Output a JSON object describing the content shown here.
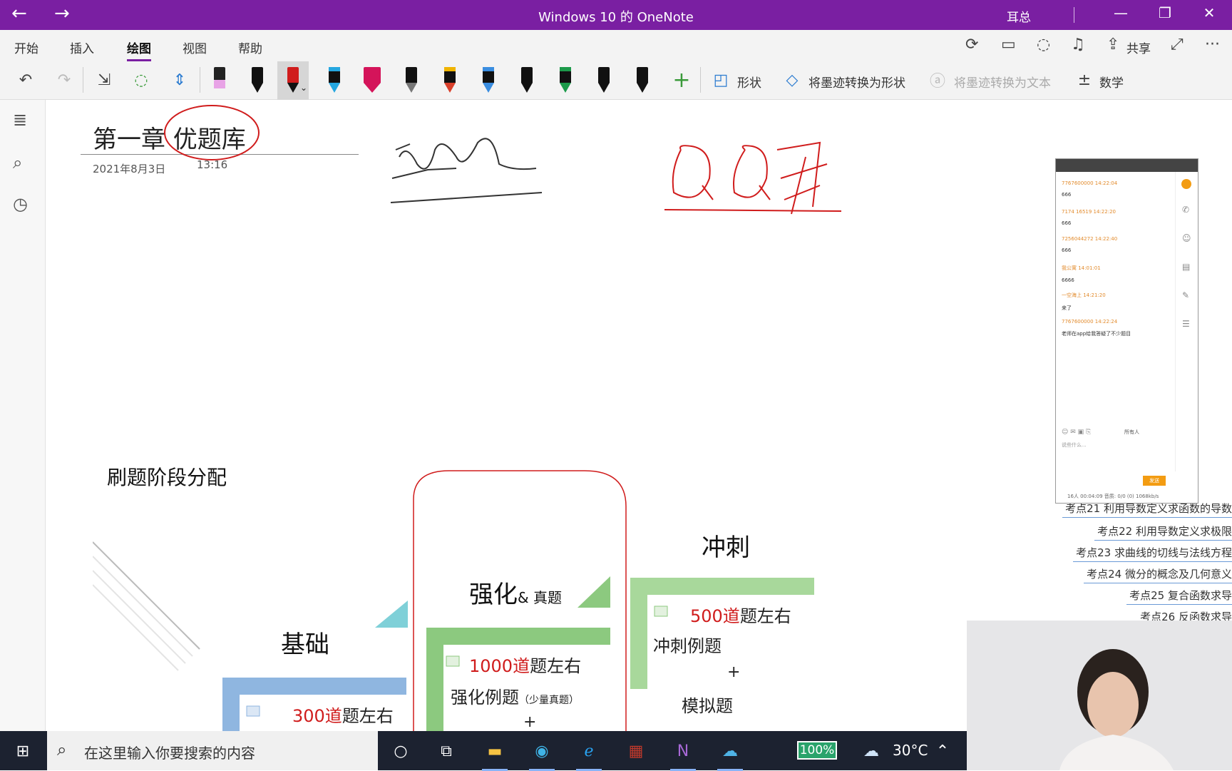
{
  "titlebar": {
    "title": "Windows 10 的 OneNote",
    "user": "耳总",
    "back": "←",
    "forward": "→",
    "min": "—",
    "max": "❐",
    "close": "✕"
  },
  "ribbon": {
    "tabs": [
      "开始",
      "插入",
      "绘图",
      "视图",
      "帮助"
    ],
    "active_tab": "绘图",
    "share_label": "共享",
    "more": "···",
    "shapes_label": "形状",
    "ink_to_shape_label": "将墨迹转换为形状",
    "ink_to_text_label": "将墨迹转换为文本",
    "math_label": "数学",
    "add_pen": "+"
  },
  "page": {
    "title": "第一章 优题库",
    "date": "2021年8月3日",
    "time": "13:16"
  },
  "diagram": {
    "section_title": "刷题阶段分配",
    "basic": {
      "label": "基础",
      "count": "300道",
      "suffix": "题左右"
    },
    "strengthen": {
      "label": "强化",
      "label_small": "& 真题",
      "count": "1000道",
      "suffix": "题左右",
      "line2": "强化例题",
      "line2_small": "（少量真题）",
      "plus": "+"
    },
    "sprint": {
      "label": "冲刺",
      "count": "500道",
      "suffix": "题左右",
      "line2": "冲刺例题",
      "plus": "+",
      "line3": "模拟题"
    }
  },
  "chat": {
    "messages": [
      {
        "user": "7767600000 14:22:04",
        "text": "666"
      },
      {
        "user": "7174 16519 14:22:20",
        "text": "666"
      },
      {
        "user": "7256044272 14:22:40",
        "text": "666"
      },
      {
        "user": "我公寓 14:01:01",
        "text": "6666"
      },
      {
        "user": "一空海上 14:21:20",
        "text": "来了"
      },
      {
        "user": "7767600000 14:22:24",
        "text": "老师在app给我答疑了不少题目"
      }
    ],
    "input_placeholder": "说些什么...",
    "audience": "所有人",
    "send": "发送",
    "status": "16人  00:04:09  音质: 0/0 (0) 1068kb/s"
  },
  "sidebar_points": [
    "考点21 利用导数定义求函数的导数",
    "考点22 利用导数定义求极限",
    "考点23 求曲线的切线与法线方程",
    "考点24 微分的概念及几何意义",
    "考点25 复合函数求导",
    "考点26 反函数求导"
  ],
  "taskbar": {
    "search_placeholder": "在这里输入你要搜索的内容",
    "battery": "100%",
    "weather": "30°C"
  },
  "colors": {
    "accent": "#7a1fa2",
    "ink_red": "#d01c1c",
    "green": "#8cc97f",
    "blue": "#8fb6e0",
    "teal": "#7fd0d8"
  }
}
